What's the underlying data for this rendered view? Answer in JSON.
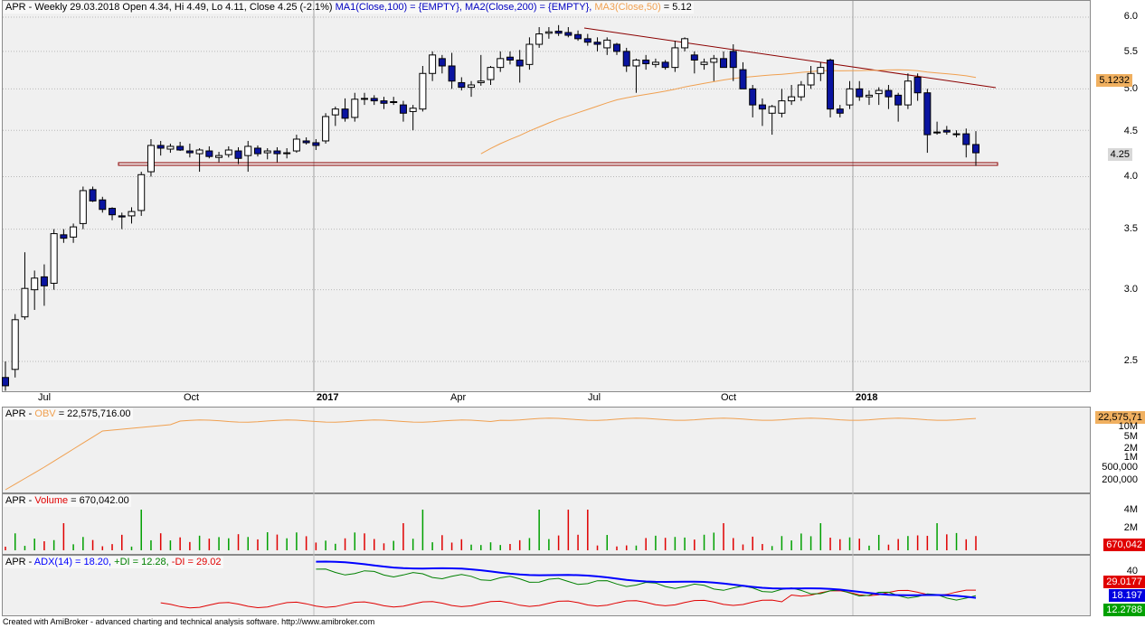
{
  "title": {
    "symbol": "APR",
    "quote": "APR - Weekly 29.03.2018 Open 4.34, Hi 4.49, Lo 4.11, Close 4.25 (-2.1%)",
    "ma1": "MA1(Close,100) = {EMPTY},",
    "ma2": "MA2(Close,200) = {EMPTY},",
    "ma3_name": "MA3(Close,50)",
    "ma3_value": " = 5.12"
  },
  "price_axis": {
    "ticks": [
      "6.0",
      "5.5",
      "5.0",
      "4.5",
      "4.0",
      "3.5",
      "3.0",
      "2.5"
    ],
    "ma_tag": "5.1232",
    "close_tag": "4.25"
  },
  "time_axis": {
    "labels": [
      "Jul",
      "Oct",
      "2017",
      "Apr",
      "Jul",
      "Oct",
      "2018"
    ]
  },
  "obv": {
    "header_prefix": "APR - ",
    "name": "OBV",
    "value_text": " = 22,575,716.00",
    "tag": "22,575,71",
    "ticks": [
      "10M",
      "5M",
      "2M",
      "1M",
      "500,000",
      "200,000"
    ]
  },
  "volume": {
    "header_prefix": "APR - ",
    "name": "Volume",
    "value_text": " = 670,042.00",
    "tag": "670,042",
    "ticks": [
      "4M",
      "2M"
    ]
  },
  "adx": {
    "header_prefix": "APR - ",
    "adx_text": "ADX(14) = 18.20,",
    "plus_text": "+DI = 12.28,",
    "minus_text": "-DI = 29.02",
    "ticks": [
      "40"
    ],
    "tag_minus": "29.0177",
    "tag_adx": "18.197",
    "tag_plus": "12.2788"
  },
  "colors": {
    "up": "#ffffff",
    "down": "#0a14a0",
    "ma3": "#f0a050",
    "trendline": "#8b0000",
    "adx": "#0000ff",
    "plus_di": "#008000",
    "minus_di": "#e00000"
  },
  "footer": "Created with AmiBroker - advanced charting and technical analysis software. http://www.amibroker.com",
  "chart_data": {
    "type": "candlestick",
    "title": "APR - Weekly 29.03.2018 Open 4.34, Hi 4.49, Lo 4.11, Close 4.25 (-2.1%)",
    "timeframe": "weekly",
    "y_scale": "log",
    "ylim": [
      2.35,
      6.1
    ],
    "last_bar": {
      "date": "29.03.2018",
      "open": 4.34,
      "high": 4.49,
      "low": 4.11,
      "close": 4.25,
      "change_pct": -2.1
    },
    "ohlc": [
      [
        2.4,
        2.5,
        2.32,
        2.35
      ],
      [
        2.45,
        2.82,
        2.4,
        2.78
      ],
      [
        2.8,
        3.3,
        2.78,
        3.01
      ],
      [
        3.0,
        3.15,
        2.85,
        3.09
      ],
      [
        3.1,
        3.2,
        2.88,
        3.03
      ],
      [
        3.05,
        3.5,
        3.0,
        3.46
      ],
      [
        3.45,
        3.5,
        3.38,
        3.42
      ],
      [
        3.43,
        3.55,
        3.38,
        3.52
      ],
      [
        3.55,
        3.9,
        3.5,
        3.86
      ],
      [
        3.87,
        3.9,
        3.75,
        3.76
      ],
      [
        3.77,
        3.8,
        3.65,
        3.68
      ],
      [
        3.69,
        3.7,
        3.58,
        3.63
      ],
      [
        3.62,
        3.65,
        3.5,
        3.61
      ],
      [
        3.62,
        3.7,
        3.55,
        3.66
      ],
      [
        3.67,
        4.05,
        3.62,
        4.02
      ],
      [
        4.05,
        4.4,
        4.0,
        4.33
      ],
      [
        4.33,
        4.38,
        4.22,
        4.3
      ],
      [
        4.29,
        4.35,
        4.25,
        4.32
      ],
      [
        4.32,
        4.37,
        4.27,
        4.28
      ],
      [
        4.27,
        4.35,
        4.2,
        4.25
      ],
      [
        4.24,
        4.3,
        4.05,
        4.28
      ],
      [
        4.27,
        4.32,
        4.19,
        4.21
      ],
      [
        4.2,
        4.26,
        4.15,
        4.22
      ],
      [
        4.23,
        4.32,
        4.2,
        4.28
      ],
      [
        4.27,
        4.31,
        4.13,
        4.19
      ],
      [
        4.22,
        4.38,
        4.05,
        4.32
      ],
      [
        4.3,
        4.33,
        4.21,
        4.24
      ],
      [
        4.25,
        4.3,
        4.18,
        4.27
      ],
      [
        4.27,
        4.31,
        4.15,
        4.24
      ],
      [
        4.24,
        4.3,
        4.19,
        4.25
      ],
      [
        4.27,
        4.45,
        4.25,
        4.4
      ],
      [
        4.38,
        4.42,
        4.34,
        4.36
      ],
      [
        4.36,
        4.4,
        4.28,
        4.33
      ],
      [
        4.38,
        4.7,
        4.35,
        4.66
      ],
      [
        4.68,
        4.78,
        4.55,
        4.75
      ],
      [
        4.75,
        4.88,
        4.6,
        4.64
      ],
      [
        4.65,
        4.95,
        4.6,
        4.87
      ],
      [
        4.88,
        4.95,
        4.8,
        4.87
      ],
      [
        4.88,
        4.92,
        4.8,
        4.85
      ],
      [
        4.85,
        4.9,
        4.75,
        4.82
      ],
      [
        4.83,
        4.9,
        4.8,
        4.84
      ],
      [
        4.8,
        4.85,
        4.6,
        4.7
      ],
      [
        4.72,
        4.8,
        4.5,
        4.76
      ],
      [
        4.75,
        5.3,
        4.72,
        5.2
      ],
      [
        5.2,
        5.5,
        5.1,
        5.45
      ],
      [
        5.4,
        5.45,
        5.2,
        5.3
      ],
      [
        5.3,
        5.48,
        5.0,
        5.1
      ],
      [
        5.08,
        5.15,
        4.98,
        5.02
      ],
      [
        5.02,
        5.1,
        4.9,
        5.05
      ],
      [
        5.08,
        5.45,
        5.04,
        5.1
      ],
      [
        5.12,
        5.3,
        5.05,
        5.28
      ],
      [
        5.28,
        5.5,
        5.22,
        5.4
      ],
      [
        5.42,
        5.5,
        5.32,
        5.38
      ],
      [
        5.38,
        5.52,
        5.08,
        5.3
      ],
      [
        5.32,
        5.7,
        5.25,
        5.6
      ],
      [
        5.6,
        5.85,
        5.55,
        5.75
      ],
      [
        5.76,
        5.85,
        5.68,
        5.78
      ],
      [
        5.79,
        5.88,
        5.72,
        5.76
      ],
      [
        5.77,
        5.85,
        5.7,
        5.73
      ],
      [
        5.74,
        5.8,
        5.65,
        5.68
      ],
      [
        5.68,
        5.75,
        5.58,
        5.63
      ],
      [
        5.63,
        5.7,
        5.5,
        5.6
      ],
      [
        5.55,
        5.7,
        5.45,
        5.66
      ],
      [
        5.6,
        5.62,
        5.45,
        5.5
      ],
      [
        5.5,
        5.55,
        5.22,
        5.3
      ],
      [
        5.3,
        5.4,
        4.95,
        5.38
      ],
      [
        5.38,
        5.45,
        5.25,
        5.33
      ],
      [
        5.32,
        5.4,
        5.28,
        5.35
      ],
      [
        5.35,
        5.38,
        5.25,
        5.28
      ],
      [
        5.28,
        5.65,
        5.22,
        5.55
      ],
      [
        5.55,
        5.7,
        5.5,
        5.68
      ],
      [
        5.45,
        5.5,
        5.2,
        5.38
      ],
      [
        5.32,
        5.4,
        5.25,
        5.35
      ],
      [
        5.35,
        5.45,
        5.1,
        5.4
      ],
      [
        5.4,
        5.5,
        5.3,
        5.28
      ],
      [
        5.5,
        5.6,
        5.1,
        5.28
      ],
      [
        5.25,
        5.35,
        5.0,
        5.0
      ],
      [
        5.0,
        5.05,
        4.65,
        4.8
      ],
      [
        4.8,
        4.88,
        4.55,
        4.75
      ],
      [
        4.7,
        4.8,
        4.45,
        4.78
      ],
      [
        4.7,
        5.0,
        4.65,
        4.85
      ],
      [
        4.85,
        5.05,
        4.8,
        4.9
      ],
      [
        4.9,
        5.1,
        4.85,
        5.05
      ],
      [
        5.05,
        5.3,
        5.0,
        5.2
      ],
      [
        5.2,
        5.35,
        5.1,
        5.28
      ],
      [
        5.38,
        5.4,
        4.65,
        4.75
      ],
      [
        4.75,
        4.8,
        4.65,
        4.7
      ],
      [
        4.8,
        5.1,
        4.75,
        5.0
      ],
      [
        5.0,
        5.1,
        4.85,
        4.9
      ],
      [
        4.9,
        4.98,
        4.8,
        4.92
      ],
      [
        4.94,
        5.02,
        4.8,
        4.98
      ],
      [
        4.98,
        5.05,
        4.75,
        4.9
      ],
      [
        4.92,
        4.95,
        4.6,
        4.8
      ],
      [
        4.8,
        5.2,
        4.75,
        5.1
      ],
      [
        5.15,
        5.2,
        4.85,
        4.95
      ],
      [
        4.95,
        5.0,
        4.25,
        4.45
      ],
      [
        4.48,
        4.6,
        4.45,
        4.48
      ],
      [
        4.5,
        4.55,
        4.45,
        4.48
      ],
      [
        4.45,
        4.5,
        4.42,
        4.46
      ],
      [
        4.46,
        4.52,
        4.2,
        4.34
      ],
      [
        4.34,
        4.49,
        4.11,
        4.25
      ]
    ],
    "ma3_close_50": {
      "start_index": 49,
      "end_value": 5.12
    },
    "obv_last": 22575716.0,
    "volume_last": 670042.0,
    "adx14": {
      "adx": 18.2,
      "plus_di": 12.28,
      "minus_di": 29.02
    }
  }
}
